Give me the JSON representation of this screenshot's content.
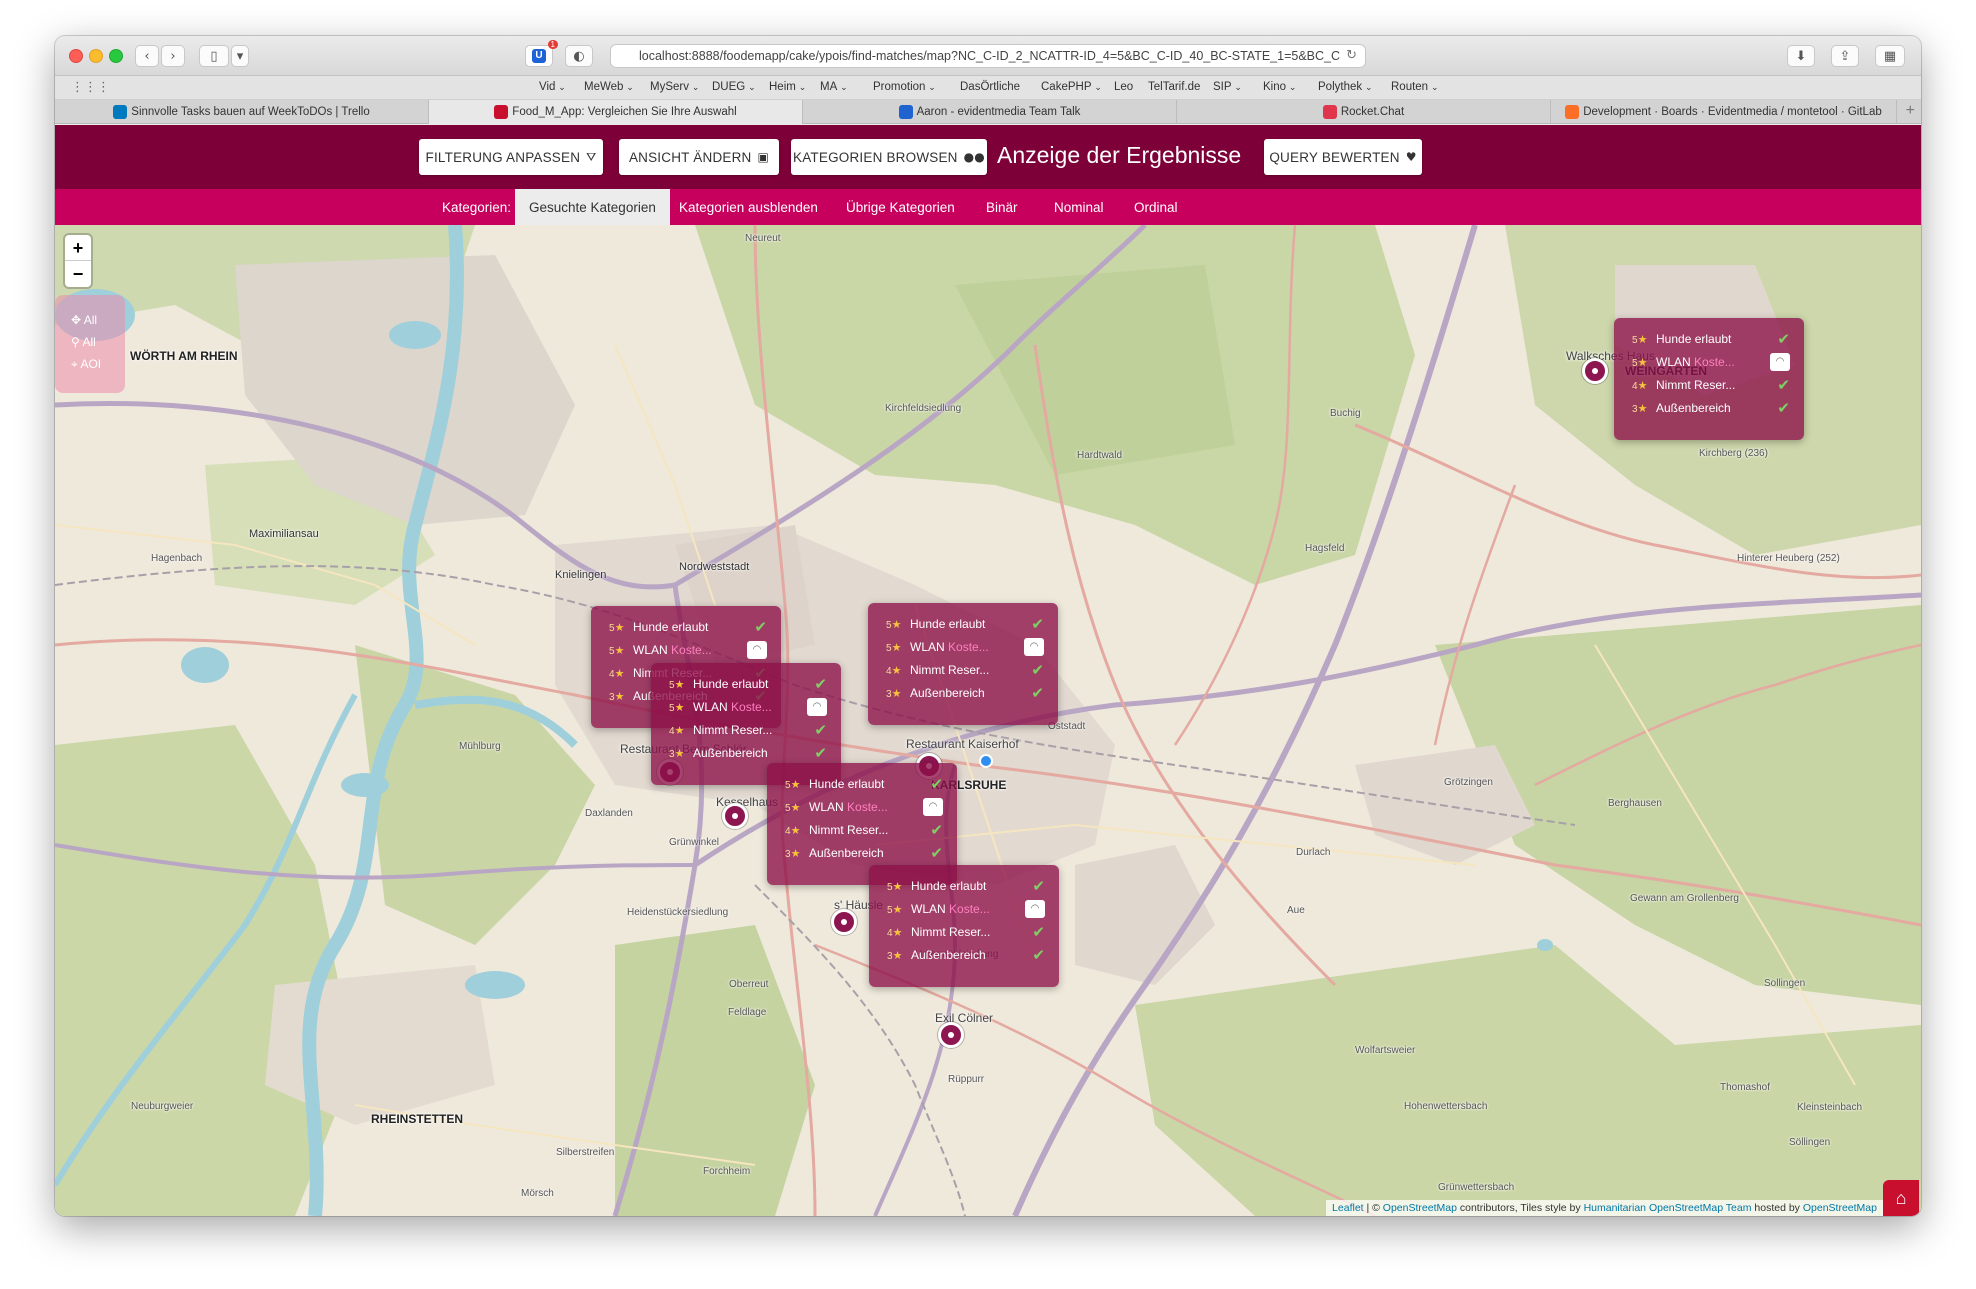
{
  "browser": {
    "url": "localhost:8888/foodemapp/cake/ypois/find-matches/map?NC_C-ID_2_NCATTR-ID_4=5&BC_C-ID_40_BC-STATE_1=5&BC_C",
    "badge_count": "1",
    "bookmarks": [
      "Vid",
      "MeWeb",
      "MyServ",
      "DUEG",
      "Heim",
      "MA",
      "Promotion",
      "DasÖrtliche",
      "CakePHP",
      "Leo",
      "TelTarif.de",
      "SIP",
      "Kino",
      "Polythek",
      "Routen"
    ],
    "bookmark_dropdown_flags": [
      true,
      true,
      true,
      true,
      true,
      true,
      true,
      false,
      true,
      false,
      false,
      true,
      true,
      true,
      true
    ],
    "tabs": [
      {
        "label": "Sinnvolle Tasks bauen auf WeekToDOs | Trello",
        "favicon_color": "#0079bf"
      },
      {
        "label": "Food_M_App: Vergleichen Sie Ihre Auswahl",
        "favicon_color": "#c8102e"
      },
      {
        "label": "Aaron - evidentmedia Team Talk",
        "favicon_color": "#1e63d0"
      },
      {
        "label": "Rocket.Chat",
        "favicon_color": "#e0364d"
      },
      {
        "label": "Development · Boards · Evidentmedia / montetool · GitLab",
        "favicon_color": "#fc6d26"
      }
    ],
    "active_tab": 1
  },
  "header": {
    "btn_filter": "FILTERUNG ANPASSEN",
    "btn_filter_icon": "funnel-icon",
    "btn_view": "ANSICHT ÄNDERN",
    "btn_view_icon": "window-icon",
    "btn_browse": "KATEGORIEN BROWSEN",
    "btn_browse_icon": "binoculars-icon",
    "title": "Anzeige der Ergebnisse",
    "btn_rate": "QUERY BEWERTEN",
    "btn_rate_icon": "heart-icon",
    "color": "#7d0038"
  },
  "subnav": {
    "label": "Kategorien:",
    "items": [
      "Gesuchte Kategorien",
      "Kategorien ausblenden",
      "Übrige Kategorien",
      "Binär",
      "Nominal",
      "Ordinal"
    ],
    "active_index": 0,
    "color": "#c6005c"
  },
  "map_controls": {
    "zoom_in": "+",
    "zoom_out": "−",
    "layers": [
      "All",
      "All",
      "AOI"
    ]
  },
  "popups": [
    {
      "rows": [
        {
          "rating": "5",
          "label": "Hunde erlaubt",
          "state": "check"
        },
        {
          "rating": "5",
          "label": "WLAN",
          "extra": "Koste...",
          "state": "wifi"
        },
        {
          "rating": "4",
          "label": "Nimmt Reser...",
          "state": "check"
        },
        {
          "rating": "3",
          "label": "Außenbereich",
          "state": "check"
        }
      ]
    },
    {
      "rows": [
        {
          "rating": "5",
          "label": "Hunde erlaubt",
          "state": "check"
        },
        {
          "rating": "5",
          "label": "WLAN",
          "extra": "Koste...",
          "state": "wifi"
        },
        {
          "rating": "4",
          "label": "Nimmt Reser...",
          "state": "check"
        },
        {
          "rating": "3",
          "label": "Außenbereich",
          "state": "check"
        }
      ]
    },
    {
      "rows": [
        {
          "rating": "5",
          "label": "Hunde erlaubt",
          "state": "check"
        },
        {
          "rating": "5",
          "label": "WLAN",
          "extra": "Koste...",
          "state": "wifi"
        },
        {
          "rating": "4",
          "label": "Nimmt Reser...",
          "state": "check"
        },
        {
          "rating": "3",
          "label": "Außenbereich",
          "state": "check"
        }
      ]
    },
    {
      "rows": [
        {
          "rating": "5",
          "label": "Hunde erlaubt",
          "state": "check"
        },
        {
          "rating": "5",
          "label": "WLAN",
          "extra": "Koste...",
          "state": "wifi"
        },
        {
          "rating": "4",
          "label": "Nimmt Reser...",
          "state": "check"
        },
        {
          "rating": "3",
          "label": "Außenbereich",
          "state": "check"
        }
      ]
    },
    {
      "rows": [
        {
          "rating": "5",
          "label": "Hunde erlaubt",
          "state": "check"
        },
        {
          "rating": "5",
          "label": "WLAN",
          "extra": "Koste...",
          "state": "wifi"
        },
        {
          "rating": "4",
          "label": "Nimmt Reser...",
          "state": "check"
        },
        {
          "rating": "3",
          "label": "Außenbereich",
          "state": "check"
        }
      ]
    },
    {
      "rows": [
        {
          "rating": "5",
          "label": "Hunde erlaubt",
          "state": "check"
        },
        {
          "rating": "5",
          "label": "WLAN",
          "extra": "Koste...",
          "state": "wifi"
        },
        {
          "rating": "4",
          "label": "Nimmt Reser...",
          "state": "check"
        },
        {
          "rating": "3",
          "label": "Außenbereich",
          "state": "check"
        }
      ]
    }
  ],
  "poi_labels": [
    "Restaurant Kaiserhof",
    "Walksches Haus",
    "Kesselhaus",
    "s' Häusle",
    "Exil Cölner",
    "Restaurant Beim Schlör"
  ],
  "places": [
    "WÖRTH AM RHEIN",
    "WEINGARTEN",
    "KARLSRUHE",
    "RHEINSTETTEN",
    "Maximiliansau",
    "Knielingen",
    "Nordweststadt",
    "Kirchfeldsiedlung",
    "Hardtwald",
    "Hagsfeld",
    "Durlach",
    "Grötzingen",
    "Berghausen",
    "Grünwinkel",
    "Heidenstückersiedlung",
    "Oststadt",
    "Aue",
    "Wolfartsweier",
    "Rüppurr",
    "Mörsch",
    "Forchheim",
    "Neureut",
    "Buchig",
    "Kirchberg (236)",
    "Hinterer Heuberg (252)",
    "Sollingen",
    "Söllingen",
    "Thomashof",
    "Kleinsteinbach",
    "Hohenwettersbach",
    "Grünwettersbach",
    "Neuburgweier",
    "Silberstreifen",
    "Feldlage",
    "Untermühlsiedlung",
    "Oberreut",
    "Daxlanden",
    "Mühlburg",
    "Hagenbach",
    "Gewann am Grollenberg"
  ],
  "attribution": {
    "leaflet": "Leaflet",
    "sep": " | © ",
    "osm": "OpenStreetMap",
    "contrib": " contributors, Tiles style by ",
    "hot": "Humanitarian OpenStreetMap Team",
    "hosted": " hosted by ",
    "host": "OpenStreetMap"
  },
  "colors": {
    "popup": "#8c1048",
    "poi": "#8e1650",
    "check": "#7fcf64"
  }
}
